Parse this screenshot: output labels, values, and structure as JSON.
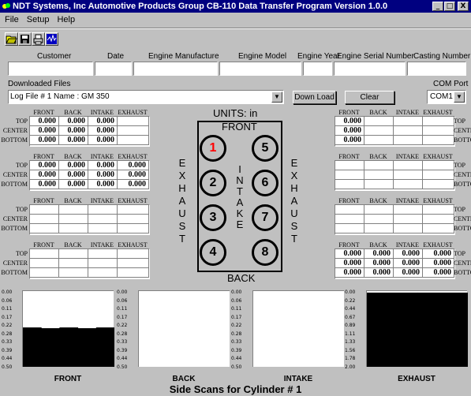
{
  "window": {
    "title": "NDT Systems, Inc  Automotive Products Group   CB-110 Data Transfer Program  Version 1.0.0",
    "minimize": "_",
    "maximize": "□",
    "close": "X"
  },
  "menu": [
    "File",
    "Setup",
    "Help"
  ],
  "toolbar": {
    "icons": [
      "open-folder-icon",
      "save-disk-icon",
      "print-icon",
      "graph-icon"
    ]
  },
  "header_fields": {
    "labels": [
      "Customer",
      "Date",
      "Engine Manufacture",
      "Engine Model",
      "Engine Year",
      "Engine Serial Number",
      "Casting Number"
    ],
    "values": [
      "",
      "",
      "",
      "",
      "",
      "",
      ""
    ]
  },
  "downloaded_files": {
    "label": "Downloaded Files",
    "selected": "Log File # 1   Name : GM 350"
  },
  "buttons": {
    "download": "Down Load",
    "clear": "Clear"
  },
  "com_port": {
    "label": "COM Port",
    "selected": "COM1"
  },
  "units": "UNITS:  in",
  "engine": {
    "front": "FRONT",
    "back": "BACK",
    "left_side": "EXHAUST",
    "right_side": "EXHAUST",
    "center": "INTAKE",
    "cylinders": [
      "1",
      "5",
      "2",
      "6",
      "3",
      "7",
      "4",
      "8"
    ],
    "highlight_color": "#ff0000"
  },
  "table_columns": [
    "FRONT",
    "BACK",
    "INTAKE",
    "EXHAUST"
  ],
  "table_rows": [
    "TOP",
    "CENTER",
    "BOTTOM"
  ],
  "left_tables": [
    {
      "cells": [
        [
          "0.000",
          "0.000",
          "0.000",
          ""
        ],
        [
          "0.000",
          "0.000",
          "0.000",
          ""
        ],
        [
          "0.000",
          "0.000",
          "0.000",
          ""
        ]
      ]
    },
    {
      "cells": [
        [
          "0.000",
          "0.000",
          "0.000",
          "0.000"
        ],
        [
          "0.000",
          "0.000",
          "0.000",
          "0.000"
        ],
        [
          "0.000",
          "0.000",
          "0.000",
          "0.000"
        ]
      ]
    },
    {
      "cells": [
        [
          "",
          "",
          "",
          ""
        ],
        [
          "",
          "",
          "",
          ""
        ],
        [
          "",
          "",
          "",
          ""
        ]
      ]
    },
    {
      "cells": [
        [
          "",
          "",
          "",
          ""
        ],
        [
          "",
          "",
          "",
          ""
        ],
        [
          "",
          "",
          "",
          ""
        ]
      ]
    }
  ],
  "right_tables": [
    {
      "cells": [
        [
          "0.000",
          "",
          "",
          ""
        ],
        [
          "0.000",
          "",
          "",
          ""
        ],
        [
          "0.000",
          "",
          "",
          ""
        ]
      ]
    },
    {
      "cells": [
        [
          "",
          "",
          "",
          ""
        ],
        [
          "",
          "",
          "",
          ""
        ],
        [
          "",
          "",
          "",
          ""
        ]
      ]
    },
    {
      "cells": [
        [
          "",
          "",
          "",
          ""
        ],
        [
          "",
          "",
          "",
          ""
        ],
        [
          "",
          "",
          "",
          ""
        ]
      ]
    },
    {
      "cells": [
        [
          "0.000",
          "0.000",
          "0.000",
          "0.000"
        ],
        [
          "0.000",
          "0.000",
          "0.000",
          "0.000"
        ],
        [
          "0.000",
          "0.000",
          "0.000",
          "0.000"
        ]
      ]
    }
  ],
  "chart_data": [
    {
      "type": "area",
      "title": "FRONT",
      "yticks": [
        "0.00",
        "0.06",
        "0.11",
        "0.17",
        "0.22",
        "0.28",
        "0.33",
        "0.39",
        "0.44",
        "0.50"
      ],
      "ylim": [
        0,
        0.5
      ],
      "fill_from_top": [
        0.24,
        0.245,
        0.24,
        0.245,
        0.24
      ]
    },
    {
      "type": "area",
      "title": "BACK",
      "yticks": [
        "0.00",
        "0.06",
        "0.11",
        "0.17",
        "0.22",
        "0.28",
        "0.33",
        "0.39",
        "0.44",
        "0.50"
      ],
      "ylim": [
        0,
        0.5
      ],
      "fill_from_top": [
        0.5,
        0.5
      ]
    },
    {
      "type": "area",
      "title": "INTAKE",
      "yticks": [
        "0.00",
        "0.06",
        "0.11",
        "0.17",
        "0.22",
        "0.28",
        "0.33",
        "0.39",
        "0.44",
        "0.50"
      ],
      "ylim": [
        0,
        0.5
      ],
      "fill_from_top": [
        0.5,
        0.5
      ]
    },
    {
      "type": "area",
      "title": "EXHAUST",
      "yticks": [
        "0.00",
        "0.22",
        "0.44",
        "0.67",
        "0.89",
        "1.11",
        "1.33",
        "1.56",
        "1.78",
        "2.00"
      ],
      "ylim": [
        0,
        2.0
      ],
      "fill_from_top": [
        0.04,
        0.04
      ]
    }
  ],
  "chart_caption": "Side Scans for Cylinder # 1"
}
